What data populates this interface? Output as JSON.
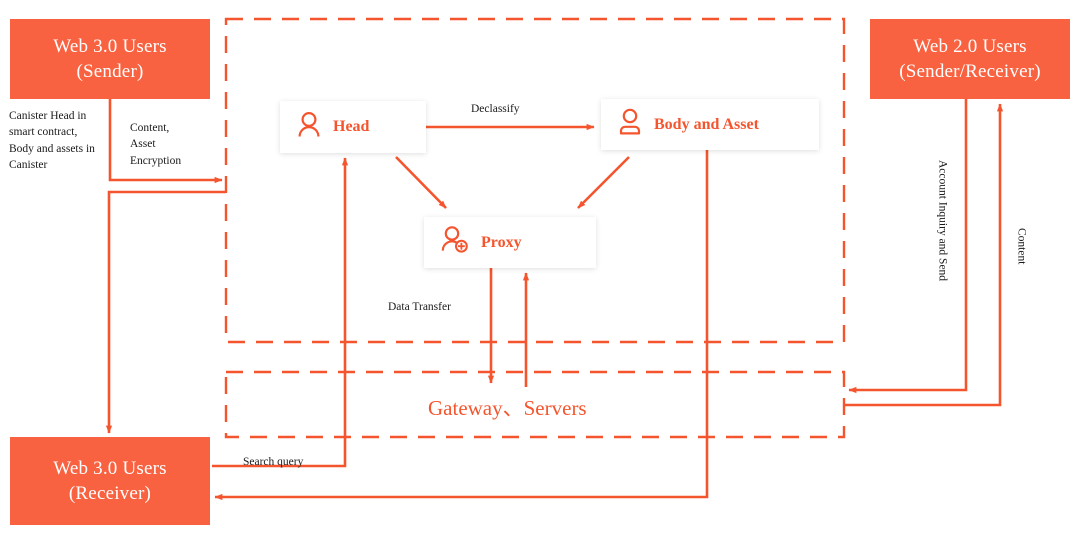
{
  "theme": {
    "accent": "#F96240",
    "accent_text": "#F4552E",
    "label_text": "#1a1a1a",
    "background": "#FFFFFF"
  },
  "actors": {
    "sender": {
      "line1": "Web 3.0 Users",
      "line2": "(Sender)"
    },
    "receiver": {
      "line1": "Web 3.0 Users",
      "line2": "(Receiver)"
    },
    "web2": {
      "line1": "Web 2.0 Users",
      "line2": "(Sender/Receiver)"
    }
  },
  "nodes": [
    {
      "id": "head",
      "label": "Head",
      "icon": "person-icon"
    },
    {
      "id": "body_asset",
      "label": "Body and Asset",
      "icon": "person-filled-icon"
    },
    {
      "id": "proxy",
      "label": "Proxy",
      "icon": "person-add-icon"
    }
  ],
  "zones": {
    "blockchain": {
      "style": "dashed"
    },
    "gateway": {
      "style": "dashed",
      "label": "Gateway、Servers"
    }
  },
  "edge_labels": {
    "canister": "Canister Head in\nsmart contract,\nBody and assets in\nCanister",
    "content_asset_encryption": "Content,\nAsset\nEncryption",
    "declassify": "Declassify",
    "data_transfer": "Data Transfer",
    "search_query": "Search query",
    "account_inquiry": "Account Inquiry and Send",
    "content": "Content"
  }
}
